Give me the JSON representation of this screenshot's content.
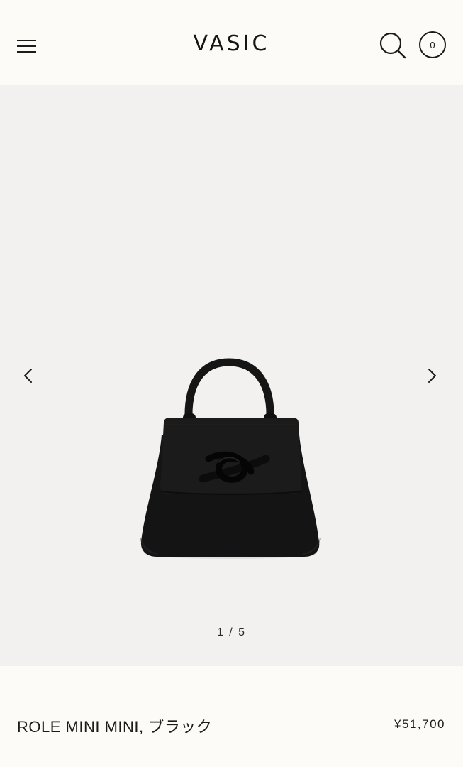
{
  "header": {
    "brand": "VASIC",
    "cart_count": "0",
    "icons": {
      "menu": "hamburger-menu-icon",
      "search": "search-icon",
      "cart": "cart-icon"
    }
  },
  "gallery": {
    "current": 1,
    "total": 5,
    "counter": "1 / 5",
    "prev_icon": "chevron-left-icon",
    "next_icon": "chevron-right-icon",
    "image": "black-handbag-product-image"
  },
  "product": {
    "name": "ROLE MINI MINI, ブラック",
    "price": "¥51,700"
  },
  "colors": {
    "background": "#fcfbf7",
    "gallery_background": "#f2f1ef",
    "text": "#1b1b1b",
    "bag": "#141414"
  }
}
